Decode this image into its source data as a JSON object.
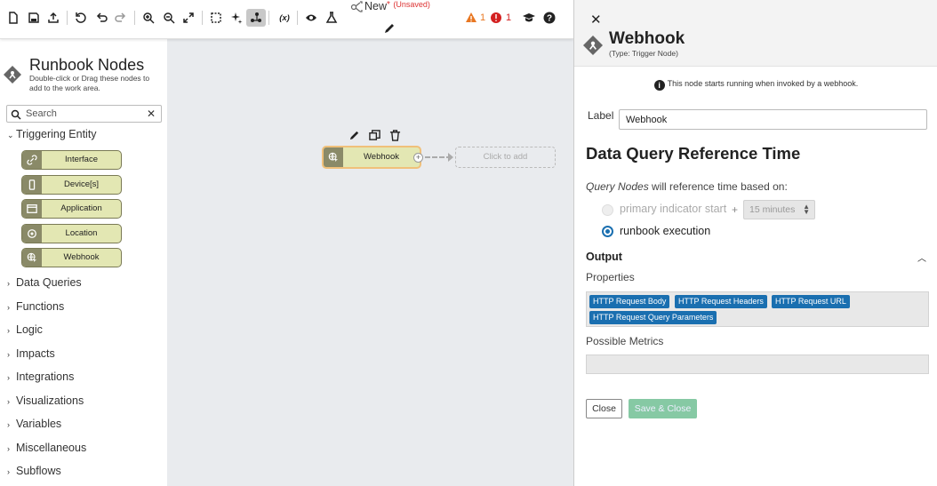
{
  "toolbar": {
    "flow_name": "New",
    "unsaved_star": "*",
    "unsaved_label": "(Unsaved)",
    "warning_count": "1",
    "error_count": "1",
    "warning_color": "#e87722",
    "error_color": "#d32020",
    "icons": [
      "new-file-icon",
      "save-icon",
      "export-icon",
      "history-icon",
      "undo-icon",
      "redo-icon",
      "zoom-in-icon",
      "zoom-out-icon",
      "fit-icon",
      "select-area-icon",
      "auto-layout-icon",
      "connect-mode-icon",
      "variables-icon",
      "preview-icon",
      "test-icon",
      "flow-icon",
      "edit-title-icon",
      "warning-icon",
      "error-icon",
      "learn-icon",
      "help-icon"
    ],
    "variables_label": "(x)"
  },
  "left_panel": {
    "title": "Runbook Nodes",
    "subtitle": "Double-click or Drag these nodes to add to the work area.",
    "search_placeholder": "Search",
    "expanded_category": "Triggering Entity",
    "trigger_nodes": [
      {
        "label": "Interface",
        "icon": "link-icon"
      },
      {
        "label": "Device[s]",
        "icon": "device-icon"
      },
      {
        "label": "Application",
        "icon": "application-icon"
      },
      {
        "label": "Location",
        "icon": "location-icon"
      },
      {
        "label": "Webhook",
        "icon": "webhook-icon"
      }
    ],
    "categories": [
      "Data Queries",
      "Functions",
      "Logic",
      "Impacts",
      "Integrations",
      "Visualizations",
      "Variables",
      "Miscellaneous",
      "Subflows"
    ]
  },
  "canvas": {
    "node_label": "Webhook",
    "placeholder_label": "Click to add"
  },
  "editor": {
    "title": "Webhook",
    "type_label": "(Type: Trigger Node)",
    "info_text": "This node starts running when invoked by a webhook.",
    "label_caption": "Label",
    "label_value": "Webhook",
    "section_title": "Data Query Reference Time",
    "query_nodes_em": "Query Nodes",
    "query_nodes_rest": " will reference time based on:",
    "option_primary": "primary indicator start",
    "plus": "+",
    "duration_value": "15 minutes",
    "option_runbook": "runbook execution",
    "selected_option": "runbook execution",
    "output_title": "Output",
    "properties_label": "Properties",
    "properties": [
      "HTTP Request Body",
      "HTTP Request Headers",
      "HTTP Request URL",
      "HTTP Request Query Parameters"
    ],
    "metrics_label": "Possible Metrics",
    "close_button": "Close",
    "save_button": "Save & Close",
    "accent_color": "#1a6fb0"
  }
}
